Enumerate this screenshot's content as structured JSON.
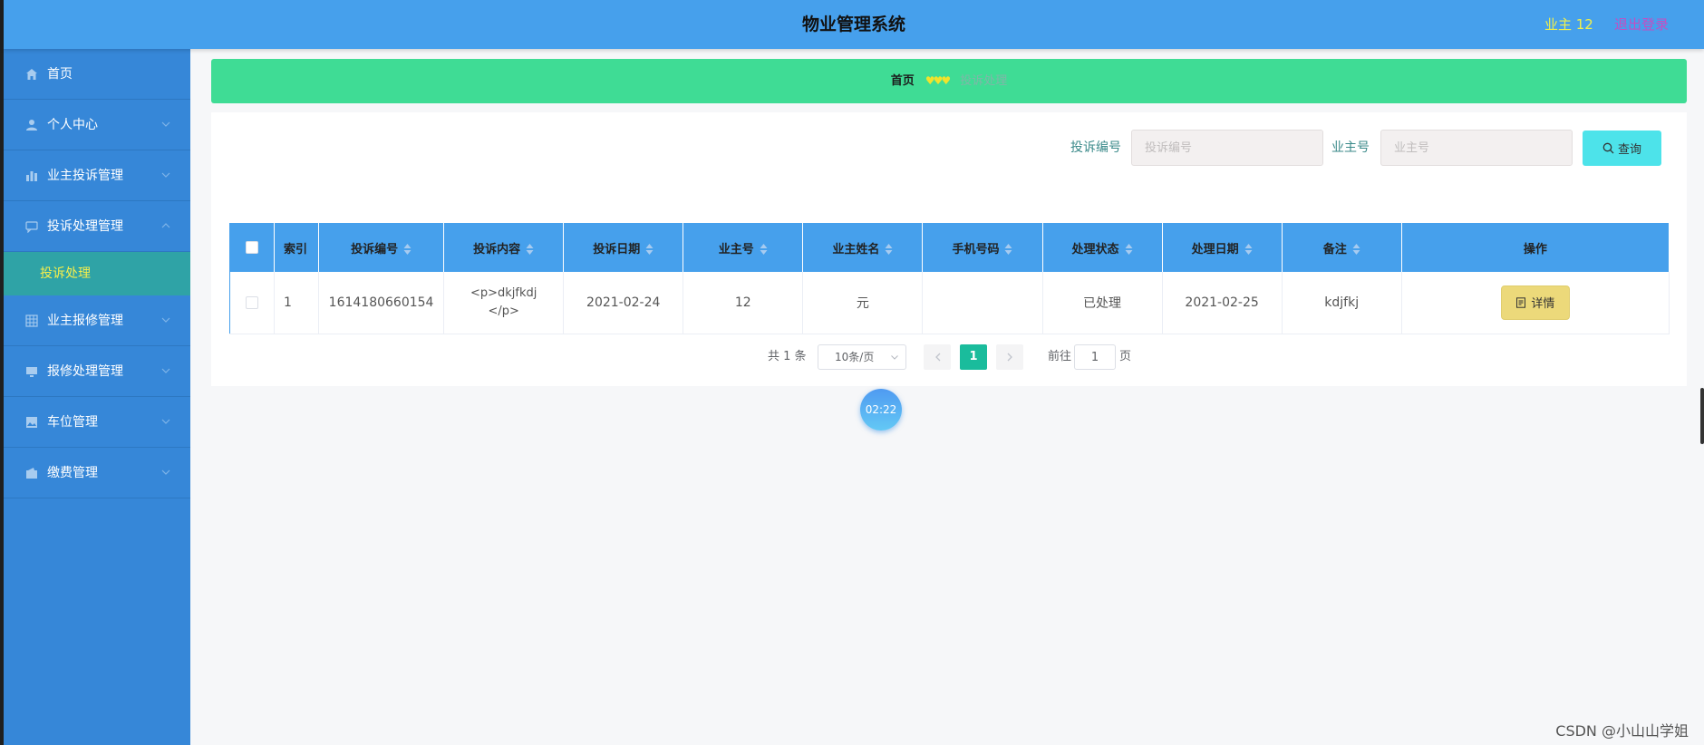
{
  "header": {
    "title": "物业管理系统",
    "user": "业主 12",
    "logout": "退出登录"
  },
  "sidebar": {
    "items": [
      {
        "label": "首页",
        "icon": "home-icon"
      },
      {
        "label": "个人中心",
        "icon": "user-icon"
      },
      {
        "label": "业主投诉管理",
        "icon": "chart-icon"
      },
      {
        "label": "投诉处理管理",
        "icon": "chat-icon"
      },
      {
        "label": "业主报修管理",
        "icon": "grid-icon"
      },
      {
        "label": "报修处理管理",
        "icon": "monitor-icon"
      },
      {
        "label": "车位管理",
        "icon": "picture-icon"
      },
      {
        "label": "缴费管理",
        "icon": "wallet-icon"
      }
    ],
    "active_sub": "投诉处理"
  },
  "breadcrumb": {
    "home": "首页",
    "separator": "♥♥♥",
    "current": "投诉处理"
  },
  "search": {
    "complaint_no_label": "投诉编号",
    "complaint_no_placeholder": "投诉编号",
    "owner_no_label": "业主号",
    "owner_no_placeholder": "业主号",
    "button": "查询"
  },
  "table": {
    "columns": [
      "索引",
      "投诉编号",
      "投诉内容",
      "投诉日期",
      "业主号",
      "业主姓名",
      "手机号码",
      "处理状态",
      "处理日期",
      "备注",
      "操作"
    ],
    "rows": [
      {
        "index": "1",
        "complaint_no": "1614180660154",
        "content": "<p>dkjfkdj </p>",
        "date": "2021-02-24",
        "owner_no": "12",
        "owner_name": "元",
        "phone": "",
        "status": "已处理",
        "handle_date": "2021-02-25",
        "remark": "kdjfkj",
        "action": "详情"
      }
    ]
  },
  "pagination": {
    "total": "共 1 条",
    "page_size": "10条/页",
    "current_page": "1",
    "goto_label": "前往",
    "goto_value": "1",
    "goto_unit": "页"
  },
  "timer": "02:22",
  "watermark": "CSDN @小山山学姐",
  "colors": {
    "header_bg": "#46a0ec",
    "sidebar_bg": "#3687d8",
    "breadcrumb_bg": "#3fdc95",
    "active_sub_bg": "#2fa3a6",
    "table_header_bg": "#46a0ec",
    "search_button_bg": "#4de3ea",
    "detail_button_bg": "#ecd97a",
    "active_page_bg": "#1abc9c"
  }
}
